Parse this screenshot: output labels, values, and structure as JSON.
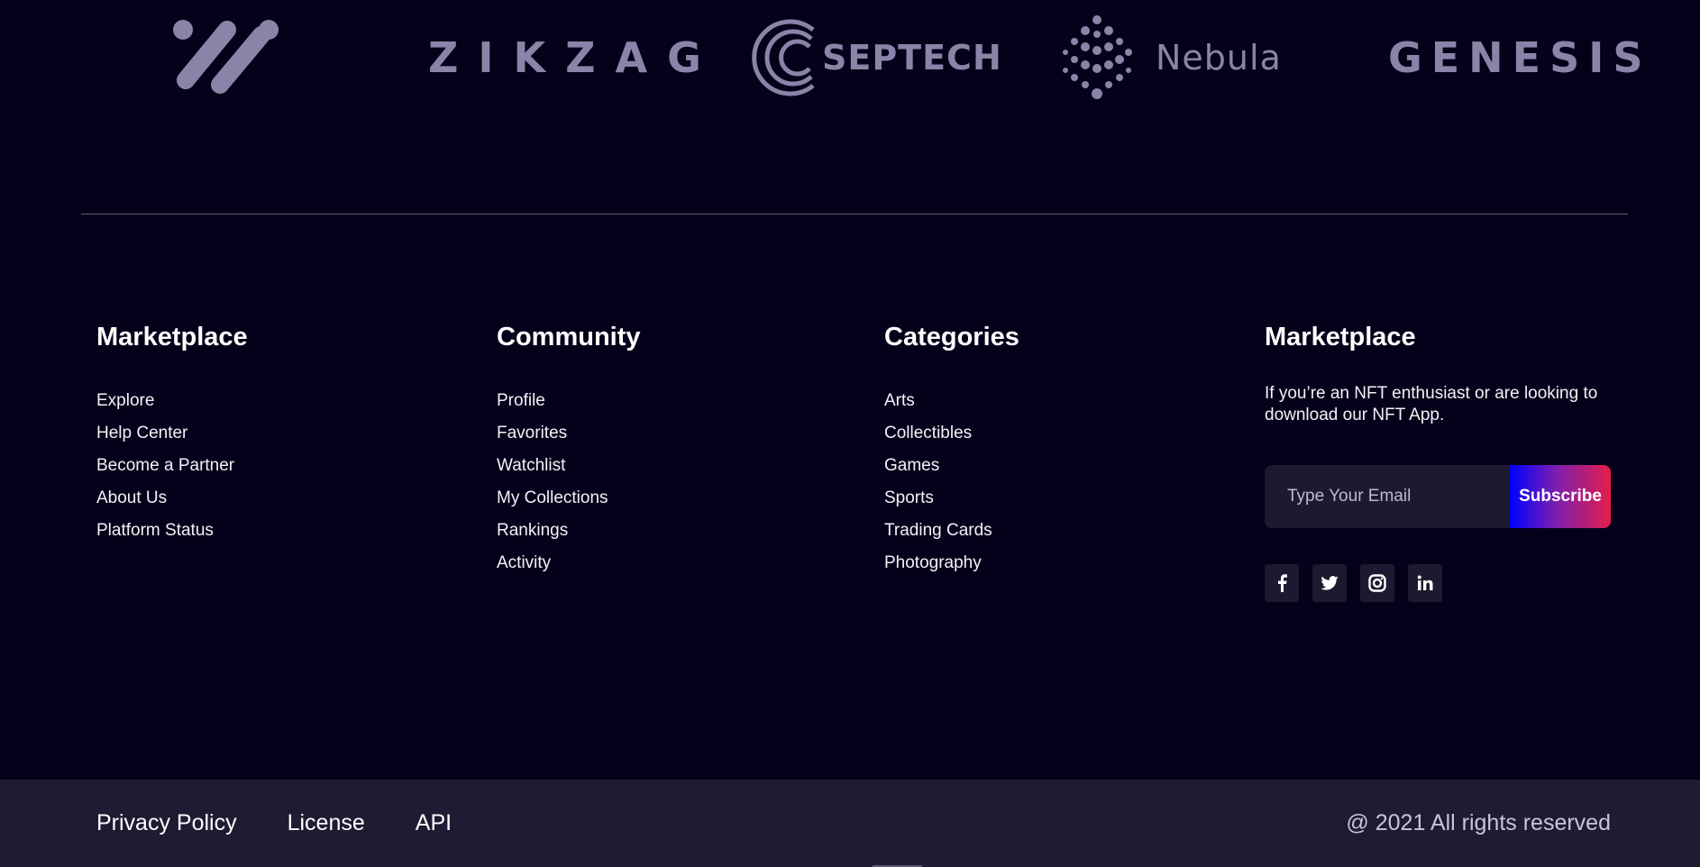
{
  "brands": [
    {
      "name": "zz-mark-logo",
      "text": ""
    },
    {
      "name": "zikzag-logo",
      "text": "ZIKZAG"
    },
    {
      "name": "septech-logo",
      "text": "SEPTECH"
    },
    {
      "name": "nebula-logo",
      "text": "Nebula"
    },
    {
      "name": "genesis-logo",
      "text": "GENESIS"
    }
  ],
  "columns": {
    "marketplace": {
      "title": "Marketplace",
      "items": [
        "Explore",
        "Help Center",
        "Become a Partner",
        "About Us",
        "Platform Status"
      ]
    },
    "community": {
      "title": "Community",
      "items": [
        "Profile",
        "Favorites",
        "Watchlist",
        "My Collections",
        "Rankings",
        "Activity"
      ]
    },
    "categories": {
      "title": "Categories",
      "items": [
        "Arts",
        "Collectibles",
        "Games",
        "Sports",
        "Trading Cards",
        "Photography"
      ]
    }
  },
  "newsletter": {
    "title": "Marketplace",
    "description": "If you’re an NFT enthusiast or are looking to download our NFT App.",
    "email_placeholder": "Type Your Email",
    "subscribe_label": "Subscribe",
    "socials": [
      {
        "name": "facebook-icon",
        "glyph": "f"
      },
      {
        "name": "twitter-icon",
        "glyph": "t"
      },
      {
        "name": "instagram-icon",
        "glyph": "ig"
      },
      {
        "name": "linkedin-icon",
        "glyph": "in"
      }
    ]
  },
  "footer": {
    "links": [
      "Privacy Policy",
      "License",
      "API"
    ],
    "copyright": "@ 2021 All rights reserved"
  },
  "colors": {
    "background": "#03021a",
    "bottom_bar": "#1e1b33",
    "logo_gray": "#8a84a8",
    "gradient_start": "#0000ff",
    "gradient_end": "#e51e4a"
  }
}
